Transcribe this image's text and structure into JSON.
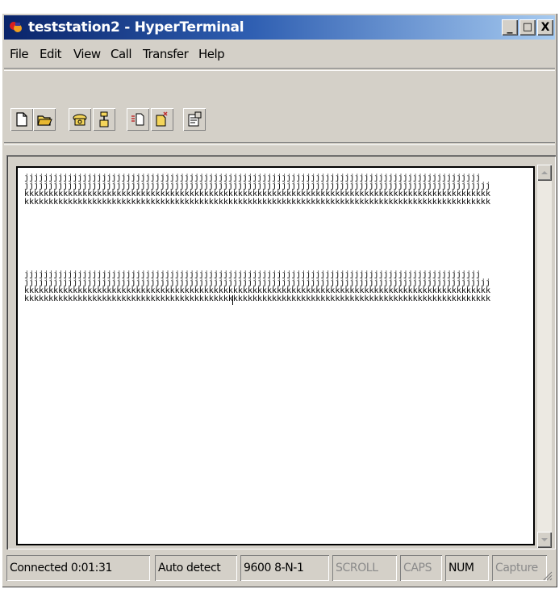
{
  "window": {
    "title": "teststation2 - HyperTerminal",
    "caption_buttons": {
      "minimize": "_",
      "maximize": "□",
      "close": "X"
    }
  },
  "menu": [
    "File",
    "Edit",
    "View",
    "Call",
    "Transfer",
    "Help"
  ],
  "toolbar": {
    "buttons": [
      "new-document-icon",
      "open-folder-icon",
      "phone-call-icon",
      "disconnect-icon",
      "send-file-icon",
      "receive-file-icon",
      "properties-icon"
    ]
  },
  "terminal": {
    "lines": [
      "jjjjjjjjjjjjjjjjjjjjjjjjjjjjjjjjjjjjjjjjjjjjjjjjjjjjjjjjjjjjjjjjjjjjjjjjjjjjjjjjjjjjjjjjjjjjjj",
      "jjjjjjjjjjjjjjjjjjjjjjjjjjjjjjjjjjjjjjjjjjjjjjjjjjjjjjjjjjjjjjjjjjjjjjjjjjjjjjjjjjjjjjjjjjjjjjjj",
      "kkkkkkkkkkkkkkkkkkkkkkkkkkkkkkkkkkkkkkkkkkkkkkkkkkkkkkkkkkkkkkkkkkkkkkkkkkkkkkkkkkkkkkkkkkkkkkkk",
      "kkkkkkkkkkkkkkkkkkkkkkkkkkkkkkkkkkkkkkkkkkkkkkkkkkkkkkkkkkkkkkkkkkkkkkkkkkkkkkkkkkkkkkkkkkkkkkkk",
      "",
      "",
      "",
      "",
      "",
      "",
      "",
      "",
      "jjjjjjjjjjjjjjjjjjjjjjjjjjjjjjjjjjjjjjjjjjjjjjjjjjjjjjjjjjjjjjjjjjjjjjjjjjjjjjjjjjjjjjjjjjjjjj",
      "jjjjjjjjjjjjjjjjjjjjjjjjjjjjjjjjjjjjjjjjjjjjjjjjjjjjjjjjjjjjjjjjjjjjjjjjjjjjjjjjjjjjjjjjjjjjjjjj",
      "kkkkkkkkkkkkkkkkkkkkkkkkkkkkkkkkkkkkkkkkkkkkkkkkkkkkkkkkkkkkkkkkkkkkkkkkkkkkkkkkkkkkkkkkkkkkkkkk",
      "kkkkkkkkkkkkkkkkkkkkkkkkkkkkkkkkkkkkkkkkkkkkkkkkkkkkkkkkkkkkkkkkkkkkkkkkkkkkkkkkkkkkkkkkkkkkkkkk"
    ]
  },
  "status": {
    "connection": "Connected 0:01:31",
    "detect": "Auto detect",
    "settings": "9600 8-N-1",
    "scroll": "SCROLL",
    "caps": "CAPS",
    "num": "NUM",
    "capture": "Capture"
  }
}
